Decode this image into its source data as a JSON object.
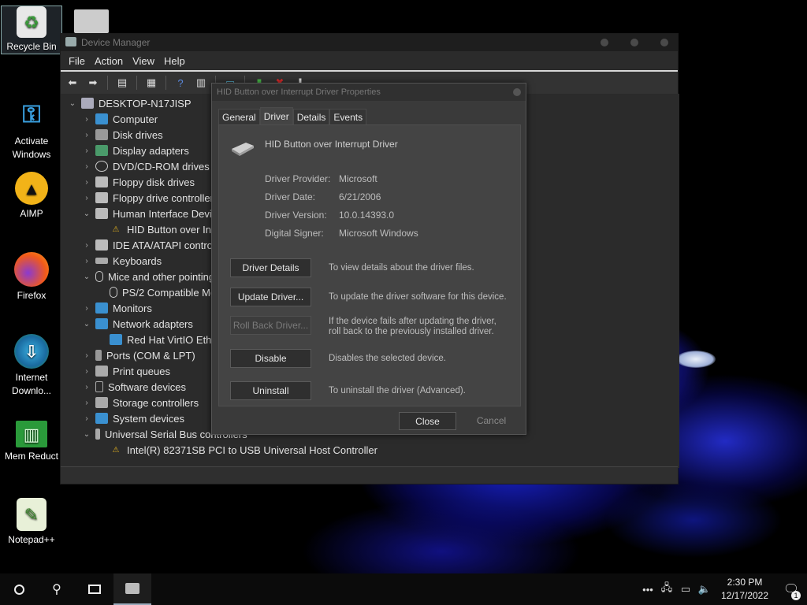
{
  "desktop": {
    "icons": [
      {
        "label": "Recycle Bin",
        "icon": "recycle-bin-icon"
      },
      {
        "label": "Activate Windows",
        "icon": "key-icon"
      },
      {
        "label": "AIMP",
        "icon": "aimp-icon"
      },
      {
        "label": "Firefox",
        "icon": "firefox-icon"
      },
      {
        "label": "Internet Downlo...",
        "icon": "internet-download-icon"
      },
      {
        "label": "Mem Reduct",
        "icon": "memory-icon"
      },
      {
        "label": "Notepad++",
        "icon": "notepadpp-icon"
      }
    ]
  },
  "device_manager": {
    "title": "Device Manager",
    "menu": [
      "File",
      "Action",
      "View",
      "Help"
    ],
    "tree": {
      "root": "DESKTOP-N17JISP",
      "nodes": [
        {
          "label": "Computer"
        },
        {
          "label": "Disk drives"
        },
        {
          "label": "Display adapters"
        },
        {
          "label": "DVD/CD-ROM drives"
        },
        {
          "label": "Floppy disk drives"
        },
        {
          "label": "Floppy drive controllers"
        },
        {
          "label": "Human Interface Devic"
        },
        {
          "label": "HID Button over Inte"
        },
        {
          "label": "IDE ATA/ATAPI controll"
        },
        {
          "label": "Keyboards"
        },
        {
          "label": "Mice and other pointing"
        },
        {
          "label": "PS/2 Compatible Mo"
        },
        {
          "label": "Monitors"
        },
        {
          "label": "Network adapters"
        },
        {
          "label": "Red Hat VirtIO Ether"
        },
        {
          "label": "Ports (COM & LPT)"
        },
        {
          "label": "Print queues"
        },
        {
          "label": "Software devices"
        },
        {
          "label": "Storage controllers"
        },
        {
          "label": "System devices"
        },
        {
          "label": "Universal Serial Bus controllers"
        },
        {
          "label": "Intel(R) 82371SB PCI to USB Universal Host Controller"
        }
      ]
    }
  },
  "dialog": {
    "title": "HID Button over Interrupt Driver Properties",
    "tabs": [
      "General",
      "Driver",
      "Details",
      "Events"
    ],
    "active_tab": "Driver",
    "device_name": "HID Button over Interrupt Driver",
    "fields": [
      {
        "label": "Driver Provider:",
        "value": "Microsoft"
      },
      {
        "label": "Driver Date:",
        "value": "6/21/2006"
      },
      {
        "label": "Driver Version:",
        "value": "10.0.14393.0"
      },
      {
        "label": "Digital Signer:",
        "value": "Microsoft Windows"
      }
    ],
    "actions": [
      {
        "label": "Driver Details",
        "desc": "To view details about the driver files."
      },
      {
        "label": "Update Driver...",
        "desc": "To update the driver software for this device."
      },
      {
        "label": "Roll Back Driver...",
        "desc": "If the device fails after updating the driver, roll back to the previously installed driver."
      },
      {
        "label": "Disable",
        "desc": "Disables the selected device."
      },
      {
        "label": "Uninstall",
        "desc": "To uninstall the driver (Advanced)."
      }
    ],
    "close_label": "Close",
    "cancel_label": "Cancel"
  },
  "taskbar": {
    "time": "2:30 PM",
    "date": "12/17/2022",
    "notification_count": "1"
  }
}
